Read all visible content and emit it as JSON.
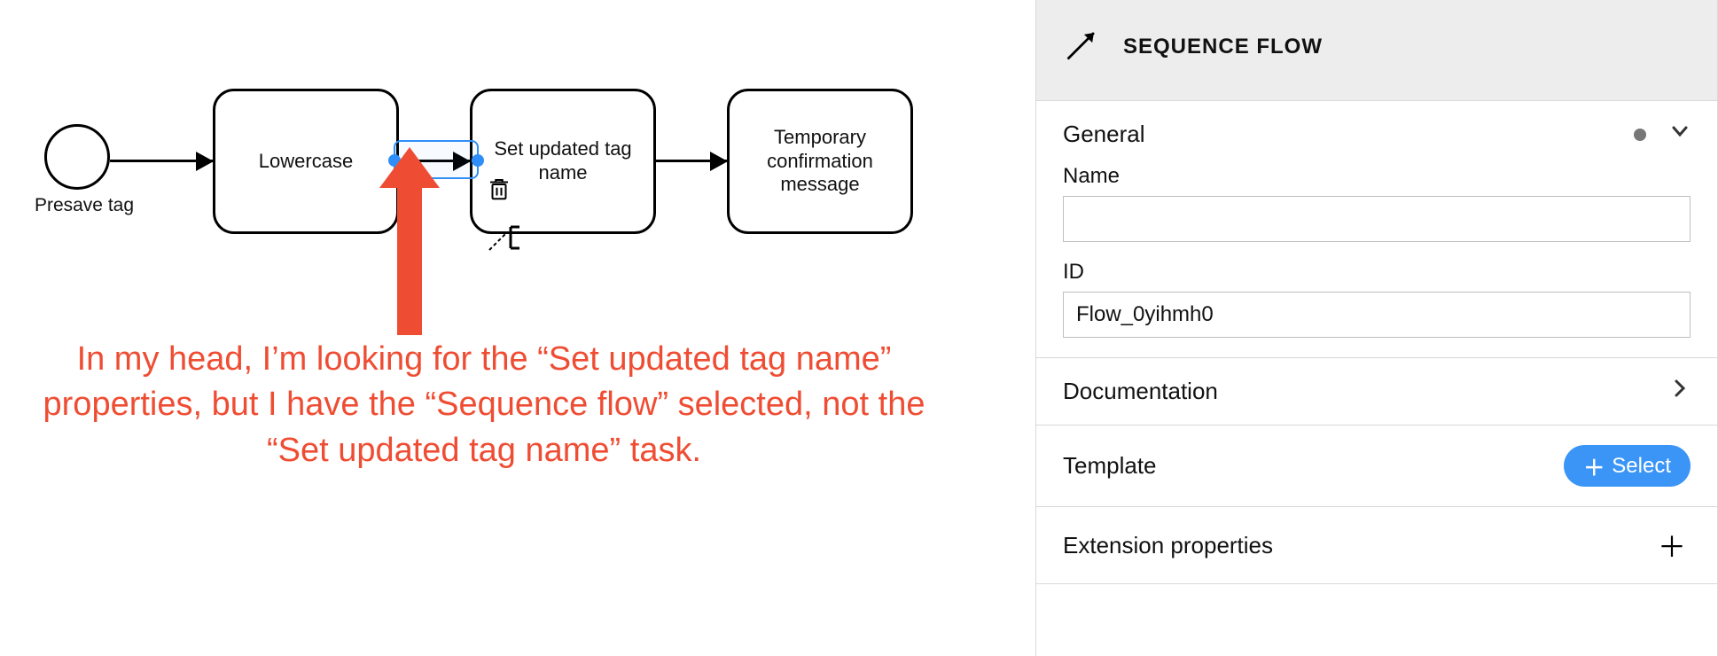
{
  "diagram": {
    "start_label": "Presave tag",
    "tasks": [
      {
        "label": "Lowercase"
      },
      {
        "label": "Set updated tag name"
      },
      {
        "label": "Temporary confirmation message"
      }
    ],
    "selected": "flow_task1_task2",
    "context_menu": {
      "delete": "delete",
      "text_annotation": "text-annotation"
    }
  },
  "annotation": {
    "text": "In my head, I’m looking for the “Set updated tag name” properties, but I have the “Sequence flow” selected, not the “Set updated tag name” task."
  },
  "panel": {
    "title": "SEQUENCE FLOW",
    "general": {
      "heading": "General",
      "name": {
        "label": "Name",
        "value": ""
      },
      "id": {
        "label": "ID",
        "value": "Flow_0yihmh0"
      }
    },
    "sections": {
      "documentation": "Documentation",
      "template": "Template",
      "template_btn": "Select",
      "ext_props": "Extension properties"
    }
  }
}
